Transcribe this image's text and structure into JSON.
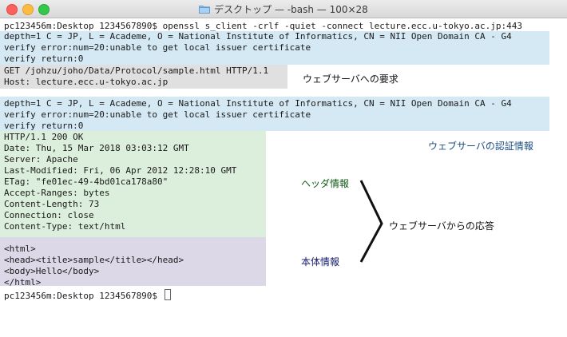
{
  "window": {
    "title": "デスクトップ — -bash — 100×28",
    "icons": {
      "title_icon": "folder-icon"
    }
  },
  "terminal": {
    "prompt_command": "pc123456m:Desktop 1234567890$ openssl s_client -crlf -quiet -connect lecture.ecc.u-tokyo.ac.jp:443",
    "tls_info_1": [
      "depth=1 C = JP, L = Academe, O = National Institute of Informatics, CN = NII Open Domain CA - G4",
      "verify error:num=20:unable to get local issuer certificate",
      "verify return:0"
    ],
    "request": [
      "GET /johzu/joho/Data/Protocol/sample.html HTTP/1.1",
      "Host: lecture.ecc.u-tokyo.ac.jp"
    ],
    "tls_info_2": [
      "depth=1 C = JP, L = Academe, O = National Institute of Informatics, CN = NII Open Domain CA - G4",
      "verify error:num=20:unable to get local issuer certificate",
      "verify return:0"
    ],
    "headers": [
      "HTTP/1.1 200 OK",
      "Date: Thu, 15 Mar 2018 03:03:12 GMT",
      "Server: Apache",
      "Last-Modified: Fri, 06 Apr 2012 12:28:10 GMT",
      "ETag: \"fe01ec-49-4bd01ca178a80\"",
      "Accept-Ranges: bytes",
      "Content-Length: 73",
      "Connection: close",
      "Content-Type: text/html"
    ],
    "body": [
      "<html>",
      "<head><title>sample</title></head>",
      "<body>Hello</body>",
      "</html>"
    ],
    "final_prompt": "pc123456m:Desktop 1234567890$ "
  },
  "annotations": {
    "request_label": "ウェブサーバへの要求",
    "cert_label": "ウェブサーバの認証情報",
    "header_label": "ヘッダ情報",
    "body_label": "本体情報",
    "response_label": "ウェブサーバからの応答"
  },
  "colors": {
    "tls_bg": "#d4e9f4",
    "request_bg": "#e0e0e0",
    "header_bg": "#dcefdc",
    "body_bg": "#dcd8e8",
    "cert_label": "#1c4f82",
    "header_label": "#0f5a14",
    "body_label": "#13196d"
  }
}
